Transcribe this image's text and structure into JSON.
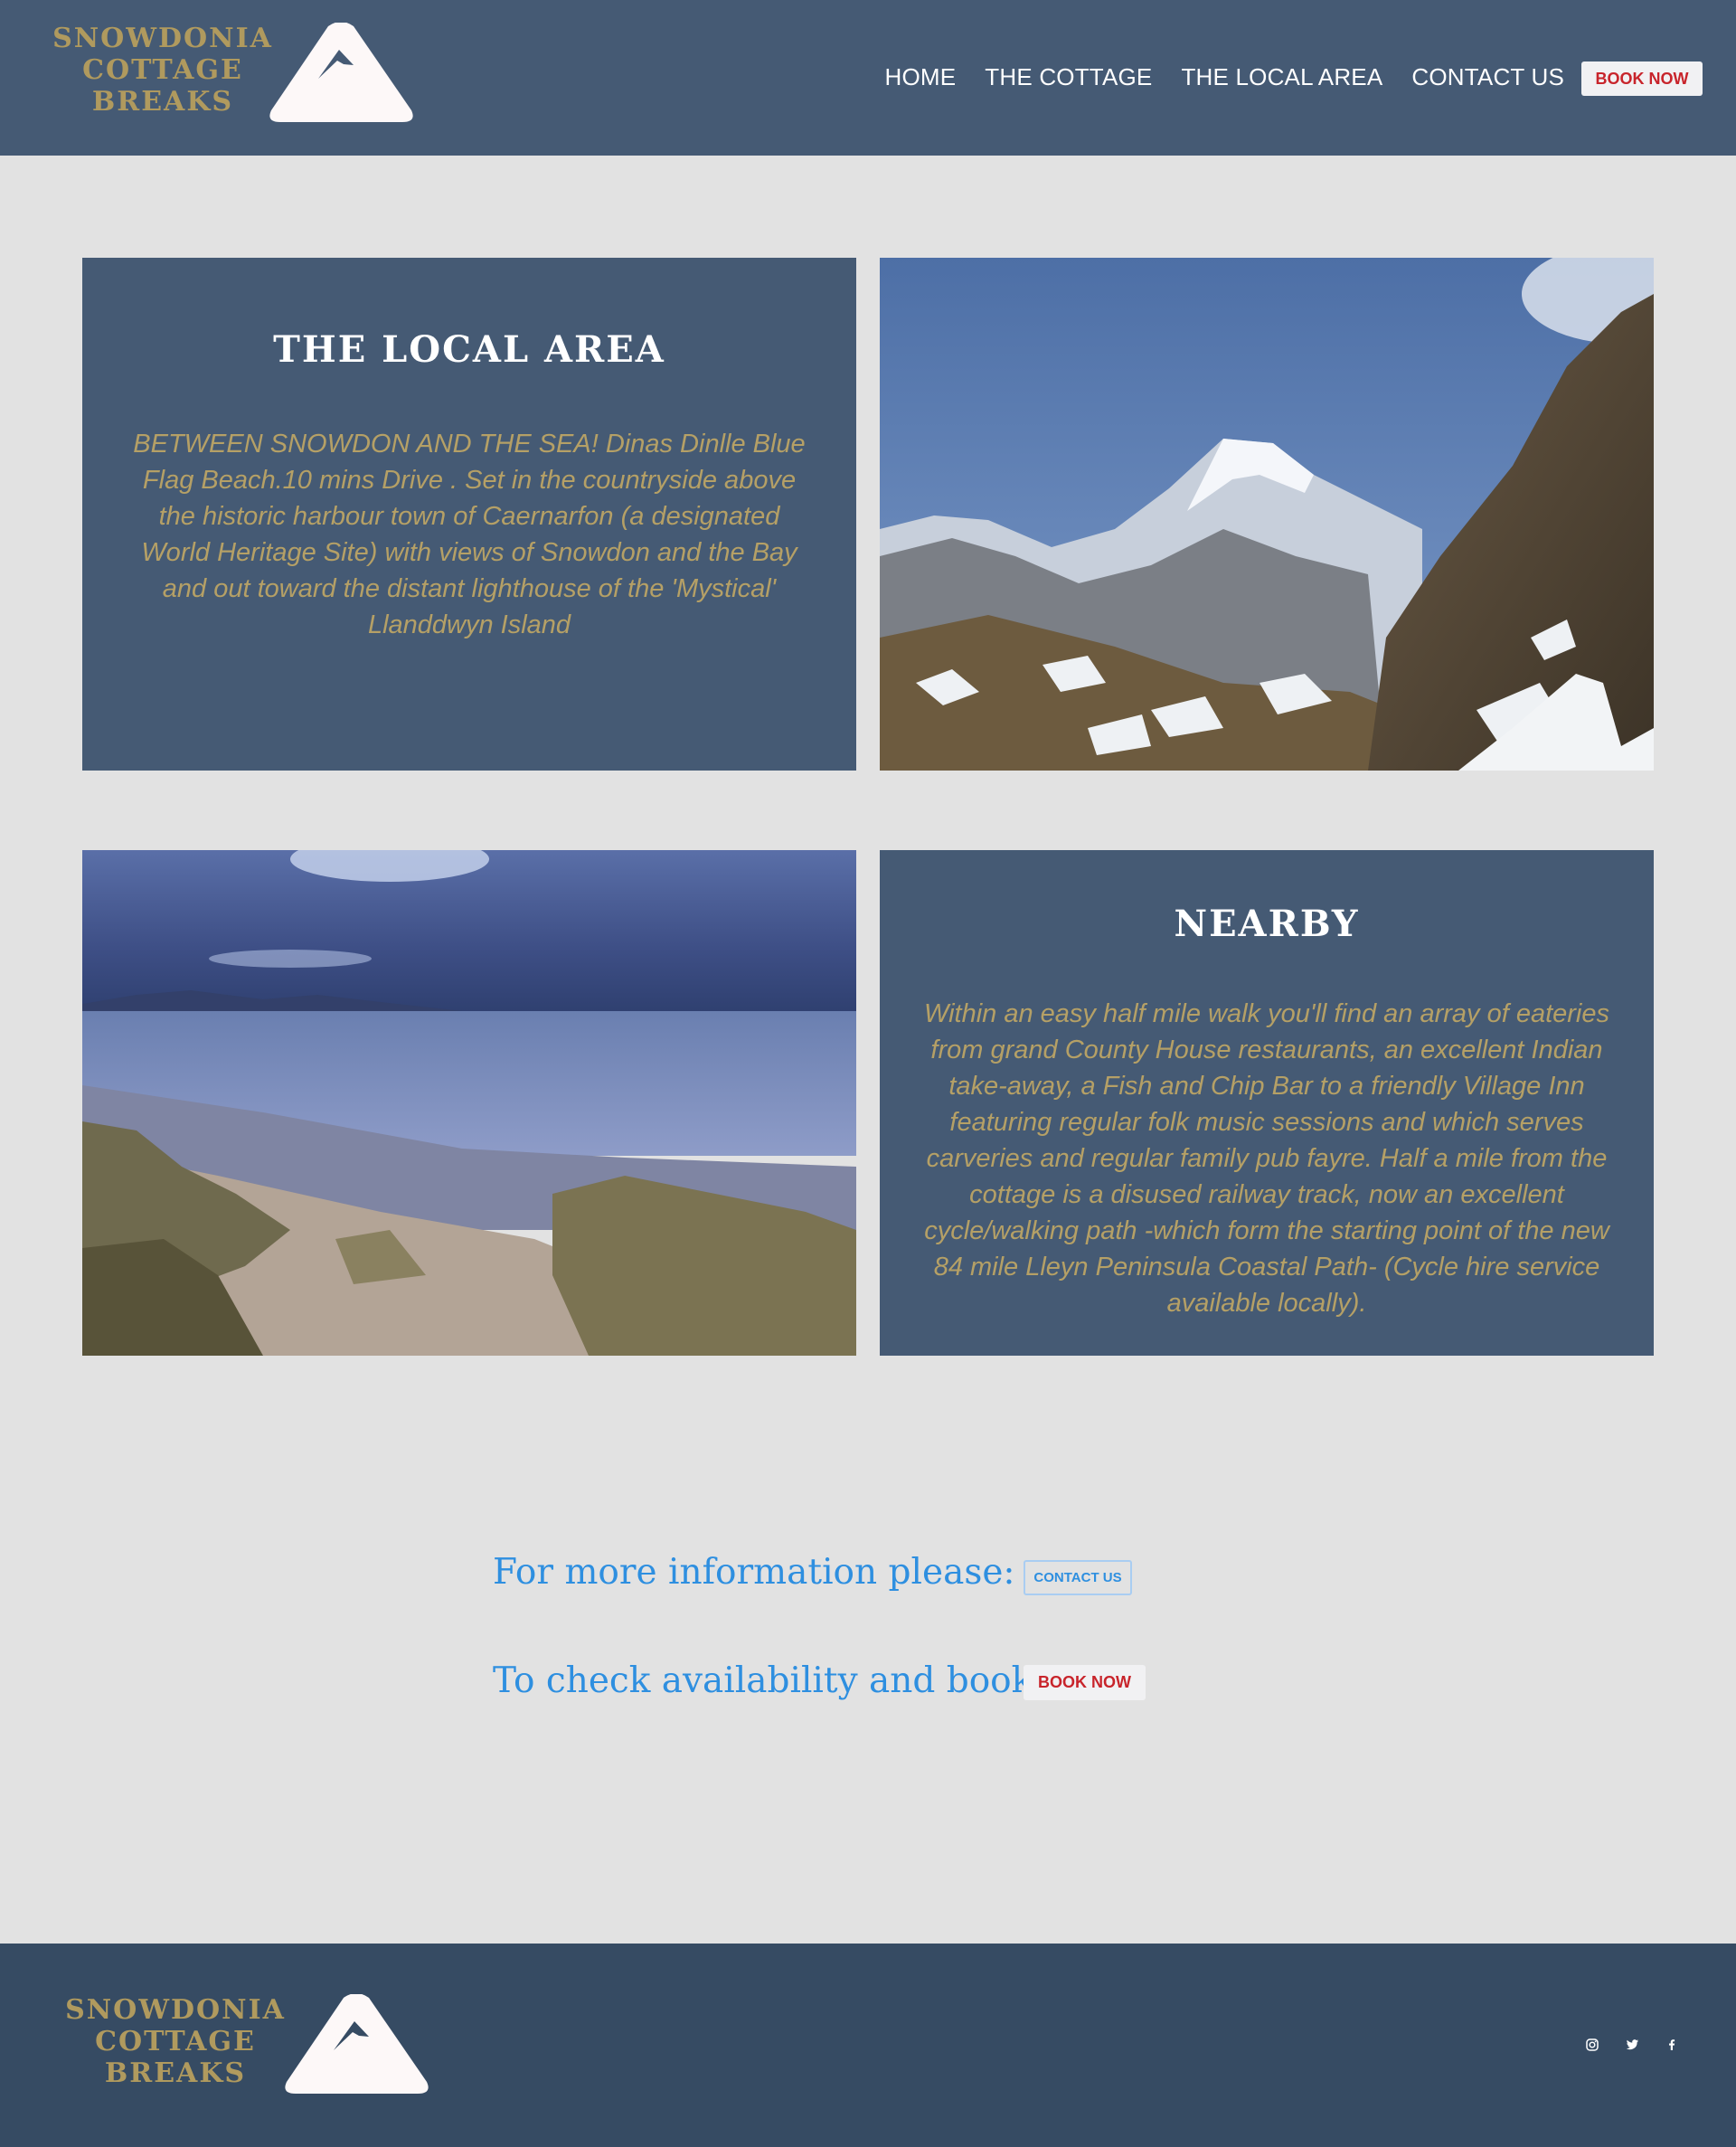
{
  "brand": {
    "line1": "SNOWDONIA",
    "line2": "COTTAGE",
    "line3": "BREAKS",
    "gold_color": "#b09a5e",
    "header_color": "#455a74",
    "footer_color": "#364b63"
  },
  "nav": {
    "items": [
      "HOME",
      "THE COTTAGE",
      "THE LOCAL AREA",
      "CONTACT US"
    ],
    "book_label": "BOOK NOW"
  },
  "local_area": {
    "title": "THE LOCAL AREA",
    "body": "BETWEEN SNOWDON AND THE SEA!  Dinas Dinlle Blue Flag Beach.10 mins Drive . Set in the countryside above the historic harbour town of Caernarfon (a designated World Heritage Site) with views of Snowdon and the Bay and out toward the distant lighthouse of the 'Mystical' Llanddwyn Island"
  },
  "nearby": {
    "title": "NEARBY",
    "body": "Within an easy half mile walk you'll find an array of eateries from grand County House restaurants, an excellent Indian take-away, a Fish and Chip Bar to a friendly Village Inn featuring regular folk music sessions and which serves carveries and regular family pub fayre. Half a mile from the cottage is a disused railway track, now an excellent cycle/walking path -which form the starting point of the new 84 mile Lleyn Peninsula Coastal Path- (Cycle hire service available locally)."
  },
  "cta": {
    "info_text": "For more information please:",
    "contact_label": "CONTACT US",
    "book_text": "To check availability and book:",
    "book_label": "BOOK NOW",
    "accent_color": "#2e8fe0"
  },
  "footer": {
    "social_icons": [
      "instagram-icon",
      "twitter-icon",
      "facebook-icon"
    ]
  }
}
